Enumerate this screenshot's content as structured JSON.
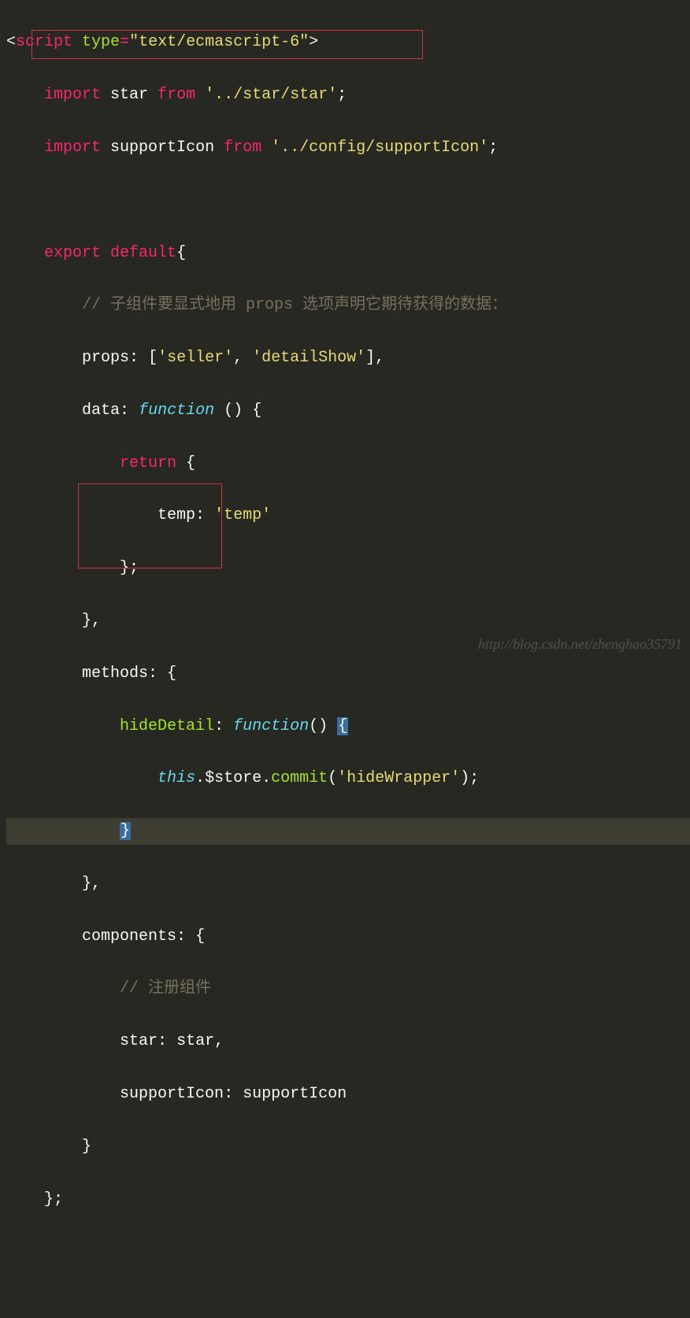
{
  "code": {
    "l1_open": "<",
    "l1_tag": "script",
    "l1_sp": " ",
    "l1_attr": "type",
    "l1_eq": "=",
    "l1_val": "\"text/ecmascript-6\"",
    "l1_close": ">",
    "l2_indent": "    ",
    "l2_import": "import",
    "l2_sp1": " ",
    "l2_id": "star",
    "l2_sp2": " ",
    "l2_from": "from",
    "l2_sp3": " ",
    "l2_path": "'../star/star'",
    "l2_semi": ";",
    "l3_indent": "    ",
    "l3_import": "import",
    "l3_sp1": " ",
    "l3_id": "supportIcon",
    "l3_sp2": " ",
    "l3_from": "from",
    "l3_sp3": " ",
    "l3_path": "'../config/supportIcon'",
    "l3_semi": ";",
    "l5_indent": "    ",
    "l5_export": "export",
    "l5_sp": " ",
    "l5_default": "default",
    "l5_brace": "{",
    "l6_indent": "        ",
    "l6_comment": "// 子组件要显式地用 props 选项声明它期待获得的数据：",
    "l7_indent": "        ",
    "l7_key": "props",
    "l7_colon": ":",
    "l7_sp": " ",
    "l7_open": "[",
    "l7_s1": "'seller'",
    "l7_comma": ", ",
    "l7_s2": "'detailShow'",
    "l7_close": "],",
    "l8_indent": "        ",
    "l8_key": "data",
    "l8_colon": ":",
    "l8_sp": " ",
    "l8_fn": "function",
    "l8_paren": " () {",
    "l9_indent": "            ",
    "l9_return": "return",
    "l9_brace": " {",
    "l10_indent": "                ",
    "l10_key": "temp",
    "l10_colon": ":",
    "l10_sp": " ",
    "l10_val": "'temp'",
    "l11_indent": "            ",
    "l11_close": "};",
    "l12_indent": "        ",
    "l12_close": "},",
    "l13_indent": "        ",
    "l13_key": "methods",
    "l13_colon": ":",
    "l13_brace": " {",
    "l14_indent": "            ",
    "l14_fn": "hideDetail",
    "l14_colon": ":",
    "l14_sp": " ",
    "l14_function": "function",
    "l14_paren": "() ",
    "l14_brace": "{",
    "l15_indent": "                ",
    "l15_this": "this",
    "l15_dot1": ".",
    "l15_store": "$store",
    "l15_dot2": ".",
    "l15_commit": "commit",
    "l15_open": "(",
    "l15_arg": "'hideWrapper'",
    "l15_close": ");",
    "l16_indent": "            ",
    "l16_brace": "}",
    "l17_indent": "        ",
    "l17_close": "},",
    "l18_indent": "        ",
    "l18_key": "components",
    "l18_colon": ":",
    "l18_brace": " {",
    "l19_indent": "            ",
    "l19_comment": "// 注册组件",
    "l20_indent": "            ",
    "l20_key": "star",
    "l20_colon": ":",
    "l20_sp": " ",
    "l20_val": "star",
    "l20_comma": ",",
    "l21_indent": "            ",
    "l21_key": "supportIcon",
    "l21_colon": ":",
    "l21_sp": " ",
    "l21_val": "supportIcon",
    "l22_indent": "        ",
    "l22_close": "}",
    "l23_indent": "    ",
    "l23_close": "};"
  },
  "watermark": "http://blog.csdn.net/zhenghao35791"
}
